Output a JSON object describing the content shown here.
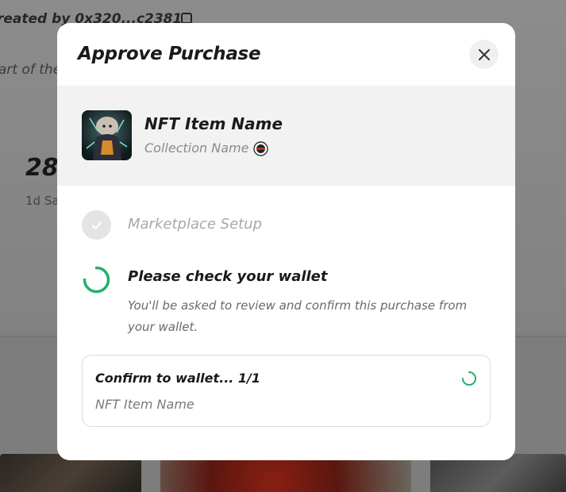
{
  "background": {
    "created_by": "reated by  0x320...c2381",
    "part_of": "art of the",
    "stat_value": "28",
    "stat_label": "1d Sa"
  },
  "modal": {
    "title": "Approve Purchase",
    "close_icon": "close-icon",
    "item": {
      "name": "NFT Item Name",
      "collection": "Collection Name"
    },
    "steps": [
      {
        "label": "Marketplace Setup",
        "status": "done"
      },
      {
        "label": "Please check your wallet",
        "status": "in-progress",
        "description": "You'll be asked to review and confirm this purchase from your wallet."
      }
    ],
    "confirm": {
      "title": "Confirm to wallet... 1/1",
      "subtitle": "NFT Item Name"
    }
  },
  "colors": {
    "accent_green": "#22b06a",
    "done_grey": "#e4e4e4",
    "panel_bg": "#f2f2f2"
  }
}
